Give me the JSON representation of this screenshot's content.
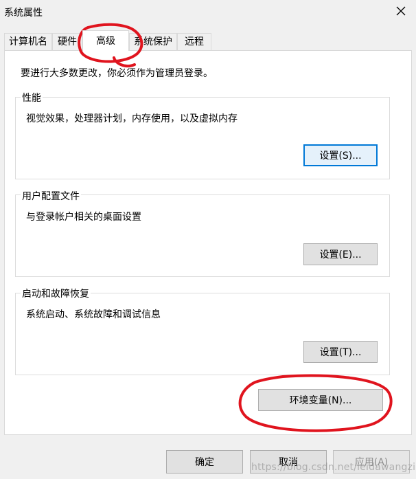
{
  "window": {
    "title": "系统属性",
    "close_icon": "close-icon"
  },
  "tabs": [
    {
      "label": "计算机名",
      "active": false
    },
    {
      "label": "硬件",
      "active": false
    },
    {
      "label": "高级",
      "active": true
    },
    {
      "label": "系统保护",
      "active": false
    },
    {
      "label": "远程",
      "active": false
    }
  ],
  "advanced": {
    "notice": "要进行大多数更改，你必须作为管理员登录。",
    "performance": {
      "title": "性能",
      "description": "视觉效果，处理器计划，内存使用，以及虚拟内存",
      "button": "设置(S)..."
    },
    "user_profiles": {
      "title": "用户配置文件",
      "description": "与登录帐户相关的桌面设置",
      "button": "设置(E)..."
    },
    "startup_recovery": {
      "title": "启动和故障恢复",
      "description": "系统启动、系统故障和调试信息",
      "button": "设置(T)..."
    },
    "env_button": "环境变量(N)..."
  },
  "footer": {
    "ok": "确定",
    "cancel": "取消",
    "apply": "应用(A)"
  },
  "watermark": "https://blog.csdn.net/leidawangzi",
  "colors": {
    "annotation": "#e0141e",
    "focus_border": "#0078d7"
  }
}
